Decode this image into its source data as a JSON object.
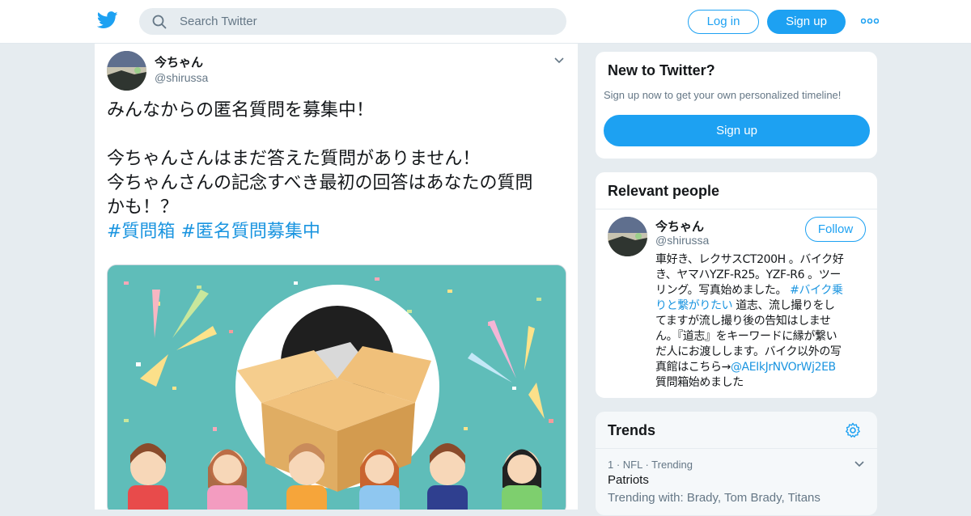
{
  "header": {
    "search_placeholder": "Search Twitter",
    "login_label": "Log in",
    "signup_label": "Sign up",
    "accent_color": "#1da1f2"
  },
  "tweet": {
    "author_name": "今ちゃん",
    "author_handle": "@shirussa",
    "lines": [
      "みんなからの匿名質問を募集中！",
      "今ちゃんさんはまだ答えた質問がありません！",
      "今ちゃんさんの記念すべき最初の回答はあなたの質問",
      "かも！？"
    ],
    "hashtags": [
      "#質問箱",
      "#匿名質問募集中"
    ],
    "image": "party-question-box-illustration"
  },
  "sidebar": {
    "new_to_twitter": {
      "title": "New to Twitter?",
      "subtitle": "Sign up now to get your own personalized timeline!",
      "signup_label": "Sign up"
    },
    "relevant_people": {
      "title": "Relevant people",
      "person": {
        "name": "今ちゃん",
        "handle": "@shirussa",
        "follow_label": "Follow",
        "bio": {
          "l1": "車好き、レクサスCT200H 。バイク好",
          "l2": "き、ヤマハYZF-R25。YZF-R6 。ツー",
          "l3_text": "リング。写真始めました。",
          "l3_link": "#バイク乗",
          "l4_link": "りと繋がりたい",
          "l4_text": " 道志、流し撮りをし",
          "l5": "てますが流し撮り後の告知はしませ",
          "l6": "ん。『道志』をキーワードに縁が繋い",
          "l7": "だ人にお渡しします。バイク以外の写",
          "l8_text": "真館はこちら→",
          "l8_link": "@AEIkJrNVOrWj2EB",
          "l9": "質問箱始めました"
        }
      }
    },
    "trends": {
      "title": "Trends",
      "items": [
        {
          "meta": "1 · NFL · Trending",
          "name": "Patriots",
          "with": "Trending with: Brady, Tom Brady, Titans"
        }
      ]
    }
  }
}
